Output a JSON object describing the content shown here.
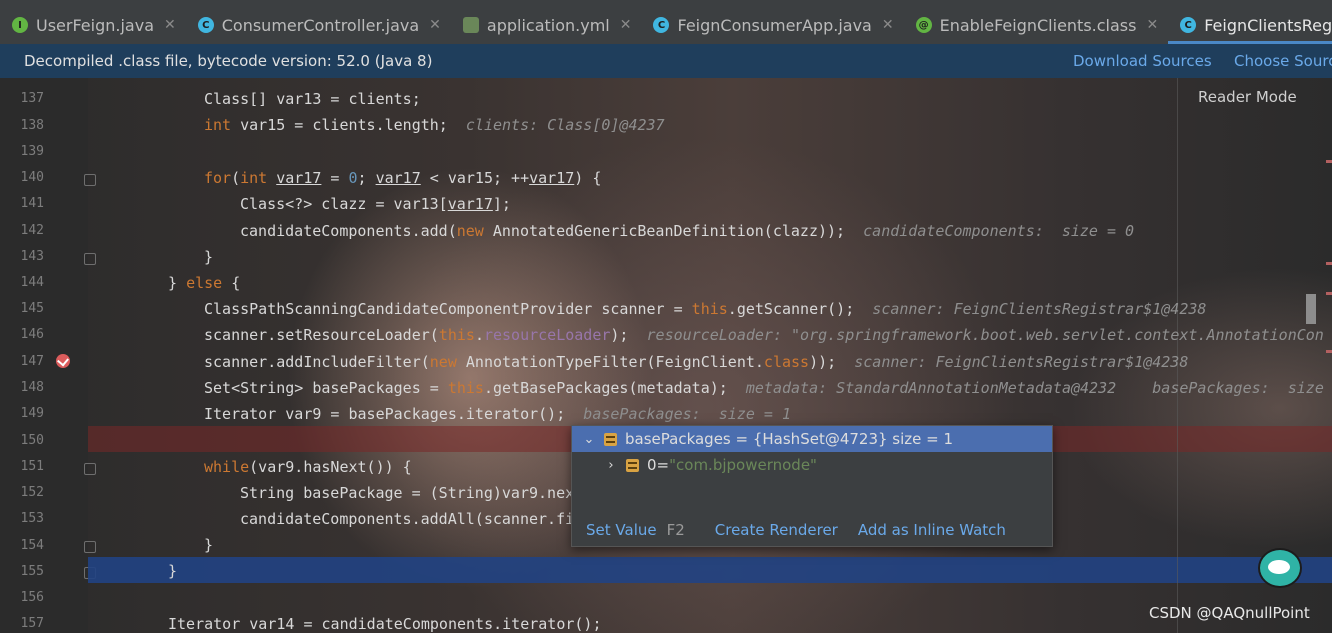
{
  "tabs": [
    {
      "label": "UserFeign.java",
      "icon": "java-class-icon",
      "active": false
    },
    {
      "label": "ConsumerController.java",
      "icon": "class-icon",
      "active": false
    },
    {
      "label": "application.yml",
      "icon": "yaml-icon",
      "active": false
    },
    {
      "label": "FeignConsumerApp.java",
      "icon": "class-icon",
      "active": false
    },
    {
      "label": "EnableFeignClients.class",
      "icon": "annotation-icon",
      "active": false
    },
    {
      "label": "FeignClientsRegistrar.class",
      "icon": "class-icon",
      "active": true
    }
  ],
  "banner": {
    "text": "Decompiled .class file, bytecode version: 52.0 (Java 8)",
    "download_sources": "Download Sources",
    "choose_sources": "Choose Sourc"
  },
  "editor": {
    "reader_mode": "Reader Mode",
    "line_numbers": [
      "137",
      "138",
      "139",
      "140",
      "141",
      "142",
      "143",
      "144",
      "145",
      "146",
      "147",
      "148",
      "149",
      "150",
      "151",
      "152",
      "153",
      "154",
      "155",
      "156",
      "157"
    ]
  },
  "code": {
    "l137": "Class[] var13 = clients;",
    "l138_a": "int",
    "l138_b": " var15 = clients.length;",
    "l138_hint": "clients: Class[0]@4237",
    "l140_for": "for",
    "l140_a": "(",
    "l140_int": "int",
    "l140_v": "var17",
    "l140_b": " = ",
    "l140_zero": "0",
    "l140_c": "; ",
    "l140_v2": "var17",
    "l140_d": " < var15; ++",
    "l140_v3": "var17",
    "l140_e": ") {",
    "l141_a": "Class<?> clazz = var13[",
    "l141_v": "var17",
    "l141_b": "];",
    "l142_a": "candidateComponents.add(",
    "l142_new": "new",
    "l142_b": " AnnotatedGenericBeanDefinition(clazz));",
    "l142_hint": "candidateComponents:  size = 0",
    "l143": "}",
    "l144_a": "} ",
    "l144_else": "else",
    "l144_b": " {",
    "l145_a": "ClassPathScanningCandidateComponentProvider scanner = ",
    "l145_this": "this",
    "l145_b": ".getScanner();",
    "l145_hint": "scanner: FeignClientsRegistrar$1@4238",
    "l146_a": "scanner.setResourceLoader(",
    "l146_this": "this",
    "l146_dot": ".",
    "l146_fld": "resourceLoader",
    "l146_b": ");",
    "l146_hint": "resourceLoader: \"org.springframework.boot.web.servlet.context.AnnotationCon",
    "l147_a": "scanner.addIncludeFilter(",
    "l147_new": "new",
    "l147_b": " AnnotationTypeFilter(FeignClient.",
    "l147_class": "class",
    "l147_c": "));",
    "l147_hint": "scanner: FeignClientsRegistrar$1@4238",
    "l148_a": "Set<String> basePackages = ",
    "l148_this": "this",
    "l148_b": ".getBasePackages(metadata);",
    "l148_hint": "metadata: StandardAnnotationMetadata@4232    basePackages:  size",
    "l149": "Iterator var9 = basePackages.iterator();",
    "l149_hint": "basePackages:  size = 1",
    "l151_while": "while",
    "l151_b": "(var9.hasNext()) {",
    "l152": "String basePackage = (String)var9.nex",
    "l153": "candidateComponents.addAll(scanner.fi",
    "l154": "}",
    "l155": "}",
    "l157": "Iterator var14 = candidateComponents.iterator();"
  },
  "popup": {
    "root_label": "basePackages = {HashSet@4723}  size = 1",
    "child_index": "0",
    "child_eq": " = ",
    "child_value": "\"com.bjpowernode\"",
    "set_value": "Set Value",
    "set_value_key": "F2",
    "create_renderer": "Create Renderer",
    "add_inline_watch": "Add as Inline Watch"
  },
  "watermark": "CSDN @QAQnullPoint",
  "colors": {
    "keyword": "#cc7832",
    "number": "#6897bb",
    "field": "#9876aa",
    "link": "#6aa9e9",
    "selection": "#4b6eaf"
  }
}
